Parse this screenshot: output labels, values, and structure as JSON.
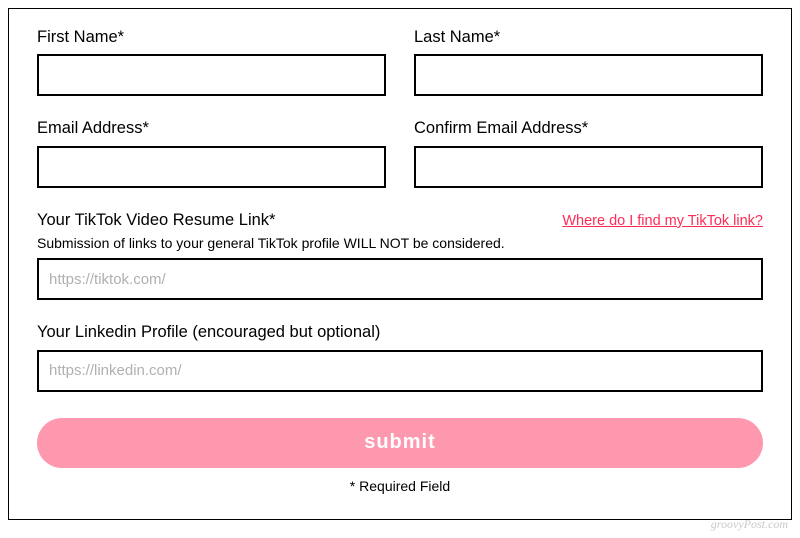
{
  "form": {
    "first_name": {
      "label": "First Name*"
    },
    "last_name": {
      "label": "Last Name*"
    },
    "email": {
      "label": "Email Address*"
    },
    "confirm_email": {
      "label": "Confirm Email Address*"
    },
    "tiktok_link": {
      "label": "Your TikTok Video Resume Link*",
      "help_link_text": "Where do I find my TikTok link?",
      "hint": "Submission of links to your general TikTok profile WILL NOT be considered.",
      "placeholder": "https://tiktok.com/"
    },
    "linkedin": {
      "label": "Your Linkedin Profile (encouraged but optional)",
      "placeholder": "https://linkedin.com/"
    },
    "submit_label": "submit",
    "required_footer": "* Required Field"
  },
  "watermark": "groovyPost.com"
}
